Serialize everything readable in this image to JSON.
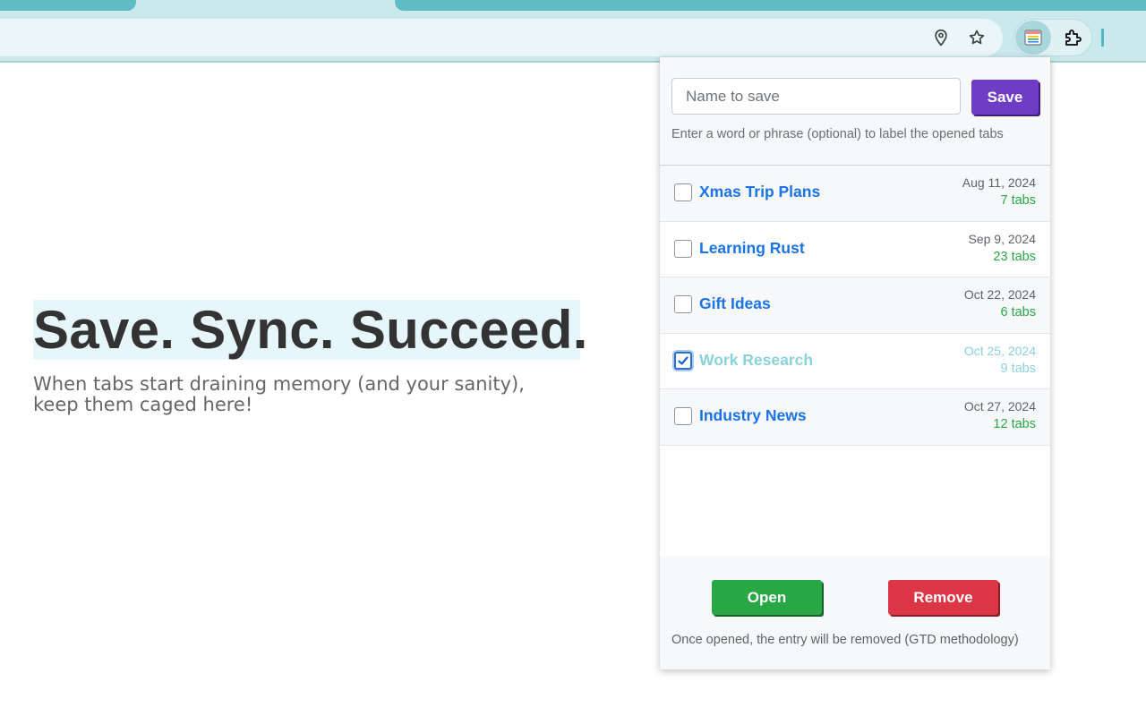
{
  "browser": {
    "toolbar_icons": [
      "location-pin-icon",
      "star-bookmark-icon",
      "tab-cage-extension-icon",
      "puzzle-extensions-icon"
    ]
  },
  "hero": {
    "title": "Save. Sync. Succeed.",
    "subtitle_line1": "When tabs start draining memory (and your sanity),",
    "subtitle_line2": "keep them caged here!"
  },
  "popup": {
    "name_input": {
      "placeholder": "Name to save",
      "value": ""
    },
    "save_label": "Save",
    "hint": "Enter a word or phrase (optional) to label the opened tabs",
    "entries": [
      {
        "title": "Xmas Trip Plans",
        "date": "Aug 11, 2024",
        "tabs": "7 tabs",
        "checked": false
      },
      {
        "title": "Learning Rust",
        "date": "Sep 9, 2024",
        "tabs": "23 tabs",
        "checked": false
      },
      {
        "title": "Gift Ideas",
        "date": "Oct 22, 2024",
        "tabs": "6 tabs",
        "checked": false
      },
      {
        "title": "Work Research",
        "date": "Oct 25, 2024",
        "tabs": "9 tabs",
        "checked": true
      },
      {
        "title": "Industry News",
        "date": "Oct 27, 2024",
        "tabs": "12 tabs",
        "checked": false
      }
    ],
    "open_label": "Open",
    "remove_label": "Remove",
    "footer_note": "Once opened, the entry will be removed (GTD methodology)"
  },
  "colors": {
    "save": "#6f3dc4",
    "open": "#28a745",
    "remove": "#dc3545",
    "link": "#1a73e8",
    "tab_count": "#28a745",
    "chrome": "#5fbcc4"
  }
}
